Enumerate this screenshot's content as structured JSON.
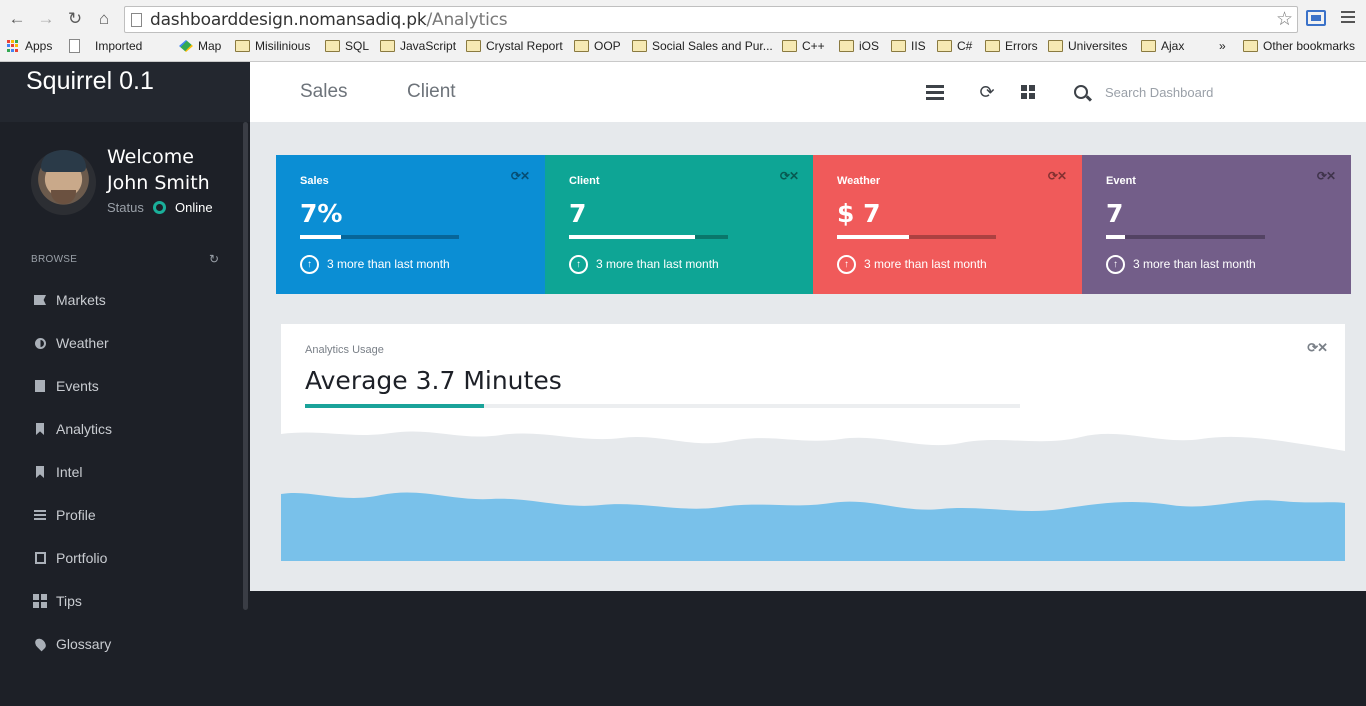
{
  "browser": {
    "url_host": "dashboarddesign.nomansadiq.pk",
    "url_path": "/Analytics",
    "bookmarks": [
      "Apps",
      "Imported",
      "Map",
      "Misilinious",
      "SQL",
      "JavaScript",
      "Crystal Report",
      "OOP",
      "Social Sales and Pur...",
      "C++",
      "iOS",
      "IIS",
      "C#",
      "Errors",
      "Universites",
      "Ajax"
    ],
    "overflow": "»",
    "other_bookmarks": "Other bookmarks"
  },
  "app": {
    "brand": "Squirrel 0.1"
  },
  "user": {
    "welcome": "Welcome",
    "name": "John Smith",
    "status_label": "Status",
    "status_value": "Online",
    "status_color": "#1aaf9a"
  },
  "sidebar": {
    "section_label": "BROWSE",
    "items": [
      {
        "label": "Markets",
        "icon": "flag-icon"
      },
      {
        "label": "Weather",
        "icon": "half-circle-icon"
      },
      {
        "label": "Events",
        "icon": "document-icon"
      },
      {
        "label": "Analytics",
        "icon": "bookmark-icon"
      },
      {
        "label": "Intel",
        "icon": "bookmark-icon"
      },
      {
        "label": "Profile",
        "icon": "lines-icon"
      },
      {
        "label": "Portfolio",
        "icon": "book-icon"
      },
      {
        "label": "Tips",
        "icon": "grid-icon"
      },
      {
        "label": "Glossary",
        "icon": "pin-icon"
      }
    ]
  },
  "topbar": {
    "tabs": [
      "Sales",
      "Client"
    ],
    "search_placeholder": "Search Dashboard"
  },
  "cards": [
    {
      "title": "Sales",
      "value": "7%",
      "progress": 0.26,
      "note": "3 more than last month",
      "color": "#0b8ed4"
    },
    {
      "title": "Client",
      "value": "7",
      "progress": 0.79,
      "note": "3 more than last month",
      "color": "#0ea595"
    },
    {
      "title": "Weather",
      "value": "$ 7",
      "progress": 0.45,
      "note": "3 more than last month",
      "color": "#f05a5a"
    },
    {
      "title": "Event",
      "value": "7",
      "progress": 0.12,
      "note": "3 more than last month",
      "color": "#735e89"
    }
  ],
  "analytics": {
    "label": "Analytics Usage",
    "title": "Average 3.7 Minutes",
    "progress": 0.25,
    "accent": "#1aa39a",
    "wave_back_color": "#e6e9ec",
    "wave_front_color": "#79c1ea"
  }
}
